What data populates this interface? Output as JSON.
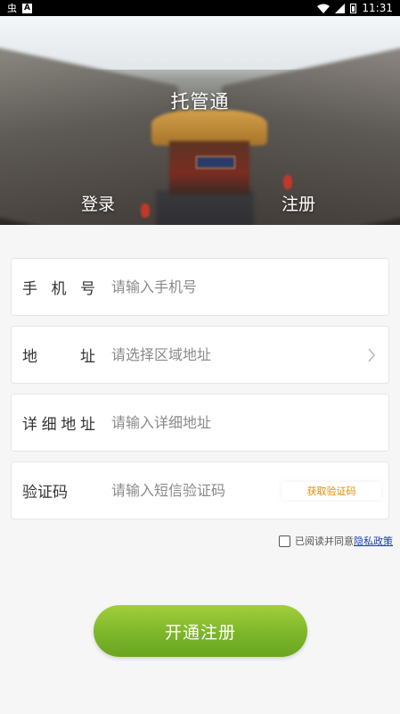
{
  "status_bar": {
    "app_icon": "虫",
    "a_icon": "A",
    "time": "11:31"
  },
  "header": {
    "title": "托管通",
    "tabs": [
      {
        "label": "登录"
      },
      {
        "label": "注册"
      }
    ],
    "active_tab": "注册"
  },
  "form": {
    "phone": {
      "label": "手机号",
      "placeholder": "请输入手机号"
    },
    "address": {
      "label": "地址",
      "placeholder": "请选择区域地址"
    },
    "detail_address": {
      "label": "详细地址",
      "placeholder": "请输入详细地址"
    },
    "code": {
      "label": "验证码",
      "placeholder": "请输入短信验证码",
      "button_label": "获取验证码"
    }
  },
  "agreement": {
    "text": "已阅读并同意",
    "link_text": "隐私政策",
    "checked": false
  },
  "submit": {
    "label": "开通注册"
  },
  "colors": {
    "accent_green": "#7cb62a",
    "code_button_text": "#e08a00",
    "link_blue": "#1d3fb8"
  }
}
